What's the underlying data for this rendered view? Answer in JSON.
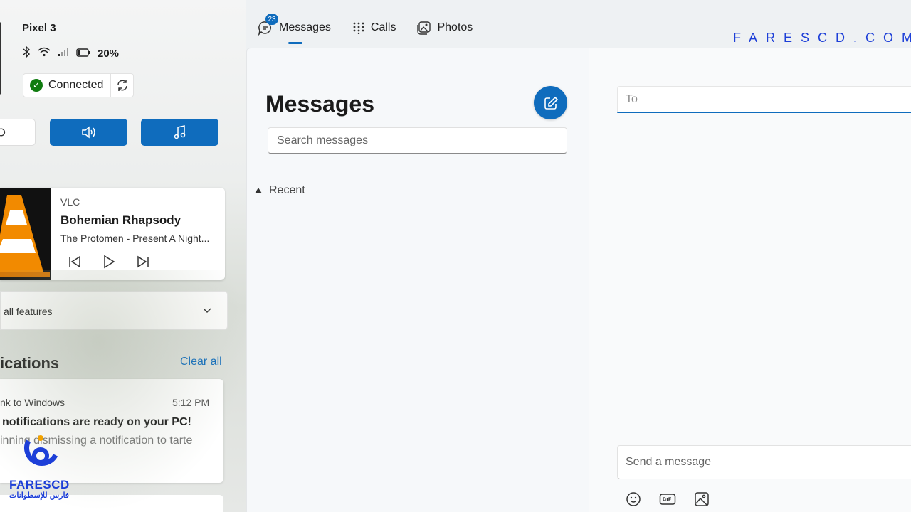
{
  "device": {
    "name": "Pixel 3",
    "battery": "20%",
    "connection_label": "Connected",
    "icons": [
      "bluetooth-icon",
      "wifi-icon",
      "signal-icon",
      "battery-icon",
      "refresh-icon"
    ]
  },
  "quick_actions": [
    "more-icon",
    "volume-icon",
    "music-icon"
  ],
  "media": {
    "app": "VLC",
    "title": "Bohemian Rhapsody",
    "artist": "The Protomen - Present A Night...",
    "controls": [
      "previous-icon",
      "play-icon",
      "next-icon"
    ]
  },
  "features_label": "all features",
  "notifications": {
    "heading": "ications",
    "clear_all": "Clear all",
    "items": [
      {
        "app": "nk to Windows",
        "time": "5:12 PM",
        "title": "notifications are ready on your PC!",
        "body": "inning dismissing a notification to tarte"
      }
    ]
  },
  "logo": {
    "name": "FARESCD",
    "subtitle": "فارس للإسطوانات",
    "color": "#1d3fd8"
  },
  "watermark": "FARESCD.COM",
  "tabs": [
    {
      "label": "Messages",
      "badge": "23",
      "active": true
    },
    {
      "label": "Calls"
    },
    {
      "label": "Photos"
    }
  ],
  "messages_pane": {
    "title": "Messages",
    "search_placeholder": "Search messages",
    "recent_label": "Recent"
  },
  "compose_pane": {
    "to_placeholder": "To",
    "message_placeholder": "Send a message",
    "tools": [
      "emoji-icon",
      "gif-icon",
      "image-icon"
    ]
  },
  "colors": {
    "accent": "#0f6cbd",
    "connected": "#107c10"
  }
}
